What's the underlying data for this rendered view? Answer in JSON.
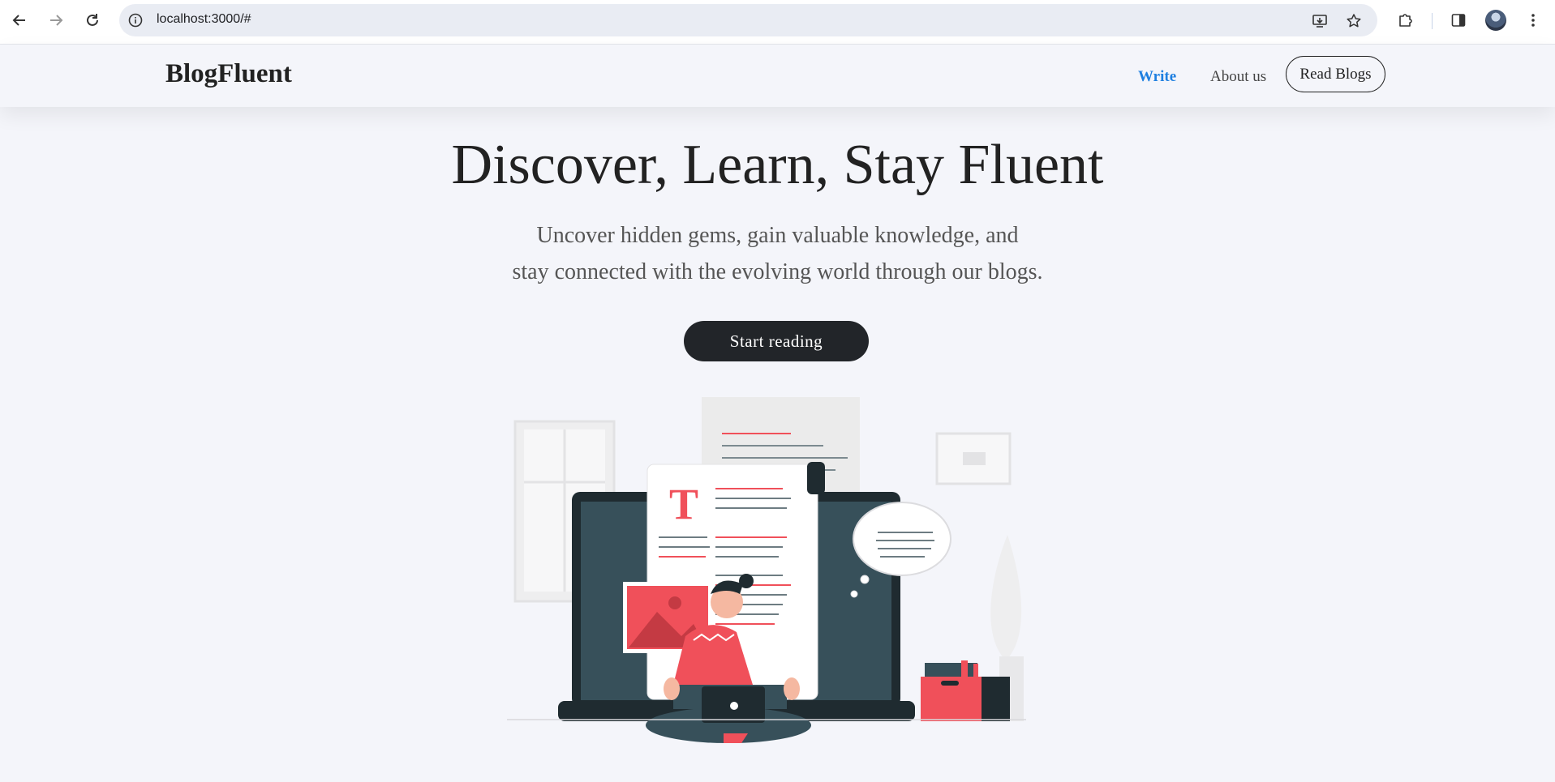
{
  "browser": {
    "url": "localhost:3000/#",
    "icons": {
      "back": "back-arrow-icon",
      "forward": "forward-arrow-icon",
      "reload": "reload-icon",
      "site_info": "info-icon",
      "install": "install-app-icon",
      "bookmark": "star-icon",
      "extensions": "puzzle-icon",
      "side_panel": "side-panel-icon",
      "menu": "kebab-menu-icon"
    }
  },
  "header": {
    "brand": "BlogFluent",
    "nav": {
      "write": "Write",
      "about": "About us",
      "read_blogs": "Read Blogs"
    }
  },
  "hero": {
    "title": "Discover, Learn, Stay Fluent",
    "subtitle_line1": "Uncover hidden gems, gain valuable knowledge, and",
    "subtitle_line2": "stay connected with the evolving world through our blogs.",
    "cta": "Start reading"
  },
  "illustration": {
    "letter": "T",
    "ellipsis": "..."
  },
  "colors": {
    "background": "#f4f5fa",
    "accent_blue": "#1e7fe0",
    "dark": "#222529",
    "red": "#f0505a",
    "slate": "#37505a"
  }
}
